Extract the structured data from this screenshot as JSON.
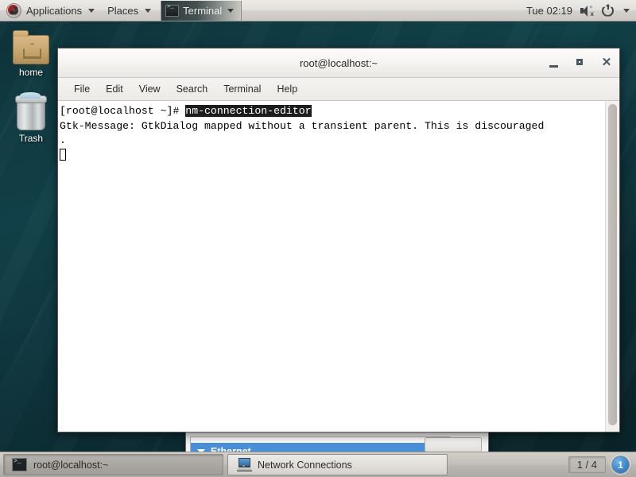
{
  "top_panel": {
    "applications_label": "Applications",
    "places_label": "Places",
    "window_menu_label": "Terminal",
    "clock": "Tue 02:19",
    "logo_icon": "centos-logo-icon",
    "volume_icon": "volume-muted-icon",
    "power_icon": "power-icon",
    "caret_icon": "chevron-down-icon"
  },
  "desktop": {
    "icons": [
      {
        "label": "home",
        "icon": "folder-home-icon"
      },
      {
        "label": "Trash",
        "icon": "trash-icon"
      }
    ]
  },
  "terminal_window": {
    "title": "root@localhost:~",
    "menus": [
      "File",
      "Edit",
      "View",
      "Search",
      "Terminal",
      "Help"
    ],
    "buttons": {
      "minimize": "–",
      "maximize": "□",
      "close": "✕"
    },
    "lines": [
      {
        "prompt": "[root@localhost ~]# ",
        "command": "nm-connection-editor",
        "selected": true
      },
      {
        "text": "Gtk-Message: GtkDialog mapped without a transient parent. This is discouraged"
      },
      {
        "text": "."
      }
    ],
    "cursor": "block-cursor"
  },
  "network_window": {
    "group_label": "Ethernet",
    "expander_icon": "triangle-down-icon",
    "buttons": [
      "",
      ""
    ]
  },
  "taskbar": {
    "items": [
      {
        "label": "root@localhost:~",
        "icon": "terminal-icon",
        "active": true
      },
      {
        "label": "Network Connections",
        "icon": "network-connections-icon",
        "active": false
      }
    ],
    "workspace_count": "1 / 4",
    "workspace_current": "1"
  },
  "colors": {
    "desktop_bg": "#0e3941",
    "panel_bg": "#e3e0dc",
    "selection_blue": "#4a90d9",
    "terminal_bg": "#ffffff",
    "terminal_fg": "#000000",
    "taskbar_bg": "#bcb9b4"
  }
}
